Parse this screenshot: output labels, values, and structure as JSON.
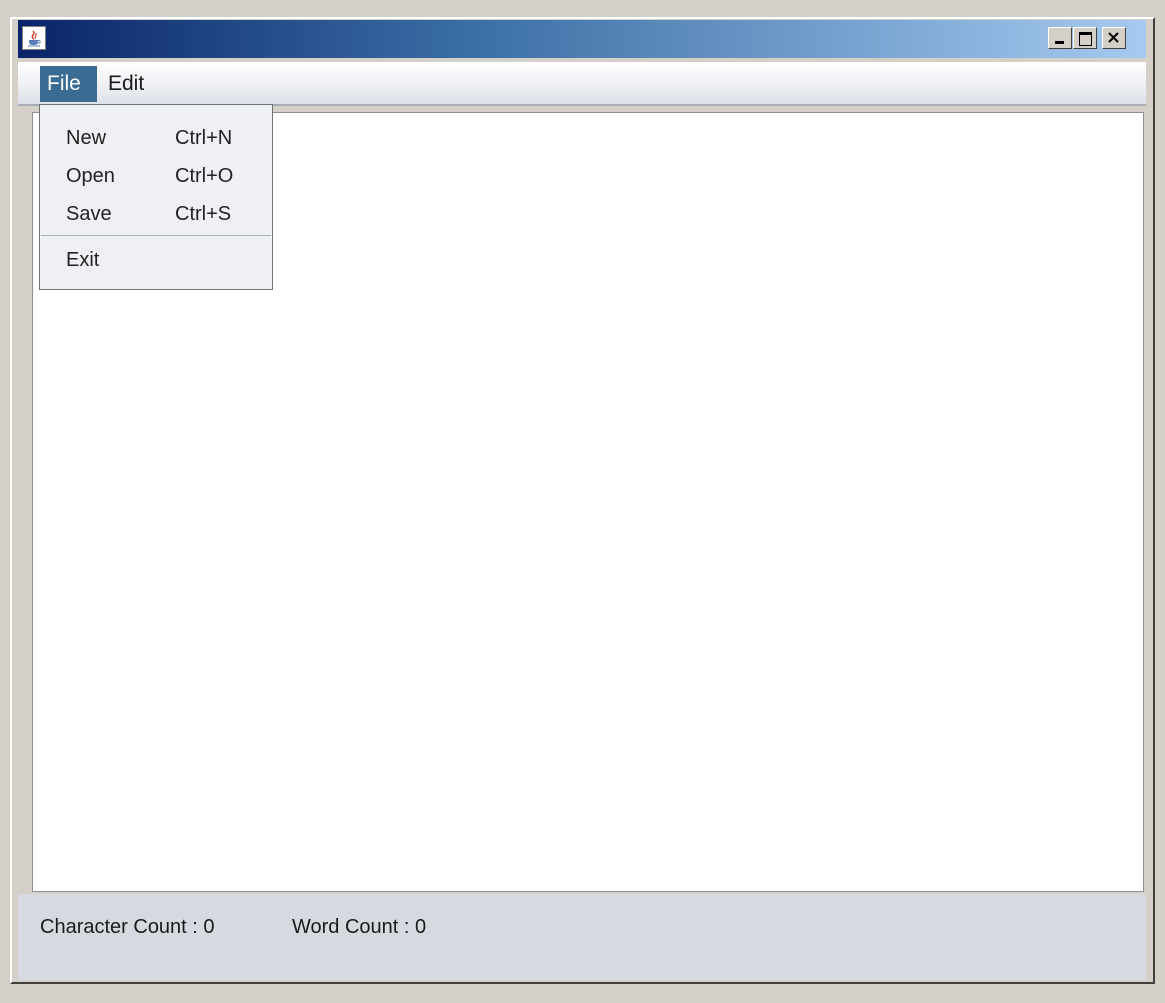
{
  "window": {
    "title": "",
    "icon": "java-coffee-icon",
    "controls": [
      "minimize-icon",
      "maximize-icon",
      "close-icon"
    ]
  },
  "menubar": {
    "items": [
      {
        "label": "File",
        "active": true
      },
      {
        "label": "Edit",
        "active": false
      }
    ]
  },
  "file_menu": {
    "items": [
      {
        "label": "New",
        "accelerator": "Ctrl+N"
      },
      {
        "label": "Open",
        "accelerator": "Ctrl+O"
      },
      {
        "label": "Save",
        "accelerator": "Ctrl+S"
      },
      {
        "label": "Exit",
        "accelerator": ""
      }
    ]
  },
  "editor": {
    "content": ""
  },
  "status": {
    "character_count_label": "Character Count :",
    "character_count_value": "0",
    "word_count_label": "Word Count :",
    "word_count_value": "0"
  },
  "colors": {
    "titlebar_start": "#0a246a",
    "titlebar_end": "#a6caf0",
    "menu_active": "#3a6b92"
  }
}
